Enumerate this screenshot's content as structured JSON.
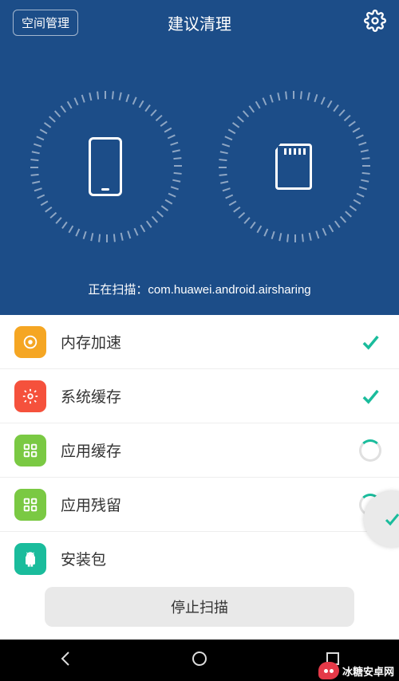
{
  "header": {
    "space_button": "空间管理",
    "title": "建议清理"
  },
  "scan_status": {
    "prefix": "正在扫描：",
    "target": "com.huawei.android.airsharing"
  },
  "items": [
    {
      "icon": "target-icon",
      "icon_class": "icon-orange",
      "label": "内存加速",
      "status": "done"
    },
    {
      "icon": "gear-icon",
      "icon_class": "icon-red",
      "label": "系统缓存",
      "status": "done"
    },
    {
      "icon": "apps-icon",
      "icon_class": "icon-green",
      "label": "应用缓存",
      "status": "loading"
    },
    {
      "icon": "apps-icon",
      "icon_class": "icon-green",
      "label": "应用残留",
      "status": "loading"
    },
    {
      "icon": "android-icon",
      "icon_class": "icon-teal",
      "label": "安装包",
      "status": "none"
    }
  ],
  "footer": {
    "stop_button": "停止扫描"
  },
  "watermark": "冰糖安卓网"
}
